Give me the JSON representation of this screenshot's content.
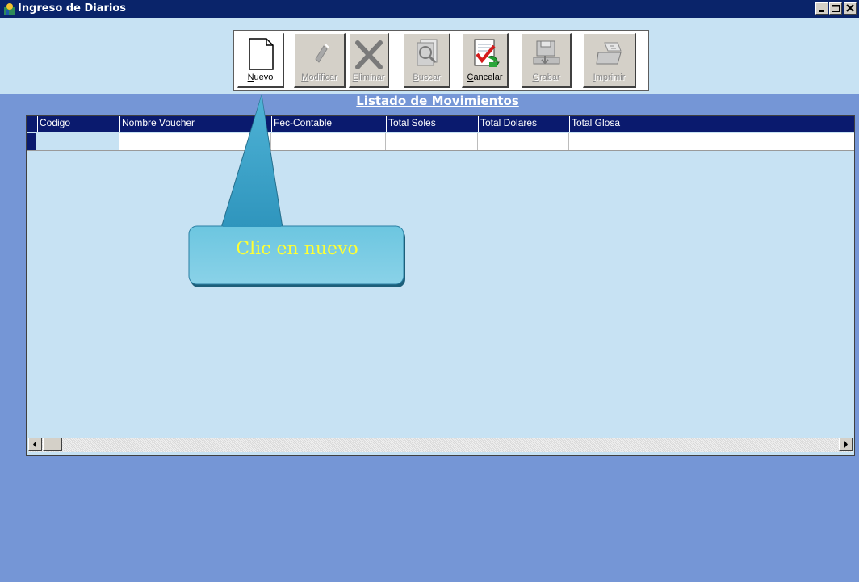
{
  "window": {
    "title": "Ingreso de Diarios"
  },
  "toolbar": {
    "buttons": [
      {
        "prefix": "",
        "accel": "N",
        "rest": "uevo",
        "icon": "new-document-icon"
      },
      {
        "prefix": "",
        "accel": "M",
        "rest": "odificar",
        "icon": "edit-pencil-icon"
      },
      {
        "prefix": "",
        "accel": "E",
        "rest": "liminar",
        "icon": "delete-x-icon"
      },
      {
        "prefix": "",
        "accel": "B",
        "rest": "uscar",
        "icon": "search-document-icon"
      },
      {
        "prefix": "",
        "accel": "C",
        "rest": "ancelar",
        "icon": "cancel-document-icon"
      },
      {
        "prefix": "",
        "accel": "G",
        "rest": "rabar",
        "icon": "save-floppy-icon"
      },
      {
        "prefix": "",
        "accel": "I",
        "rest": "mprimir",
        "icon": "print-icon"
      }
    ]
  },
  "list": {
    "title": "Listado de Movimientos",
    "columns": [
      "Codigo",
      "Nombre Voucher",
      "Fec-Contable",
      "Total Soles",
      "Total Dolares",
      "Total Glosa"
    ]
  },
  "callout": {
    "text": "Clic en nuevo"
  },
  "colors": {
    "titlebar": "#0a246a",
    "background": "#7596d6",
    "panel": "#c7e2f3",
    "header": "#0a1a6e",
    "callout_text": "#ffff33"
  }
}
